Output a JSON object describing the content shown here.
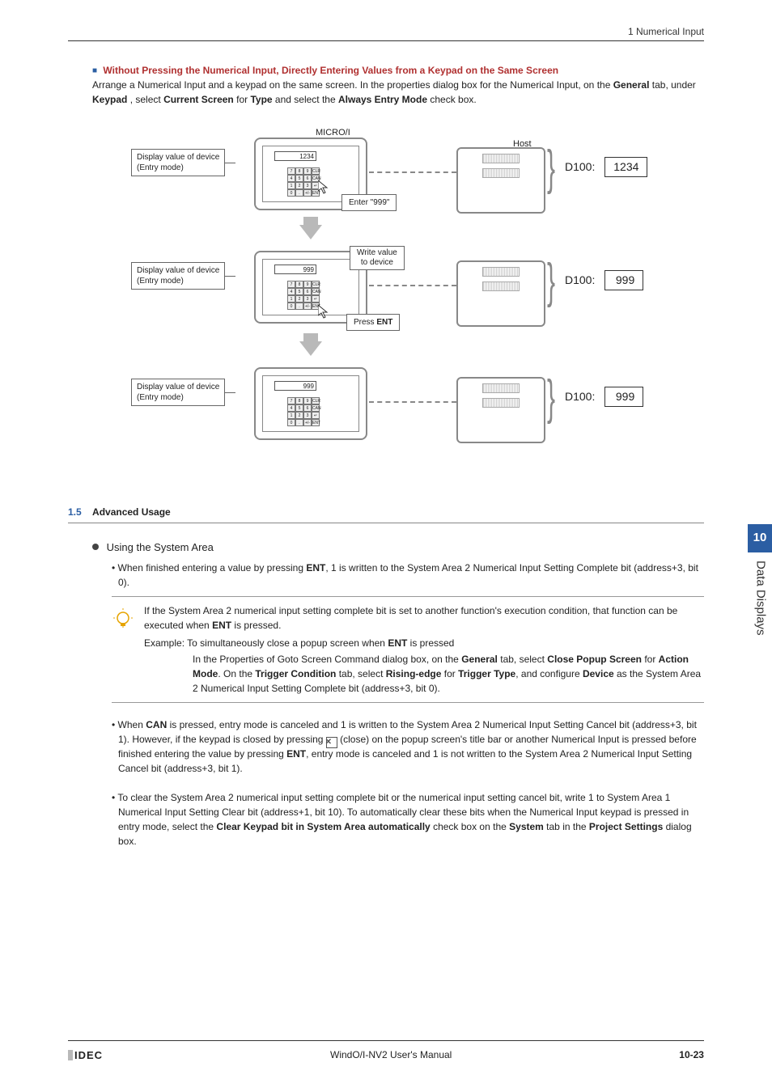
{
  "header": {
    "section": "1 Numerical Input"
  },
  "title_block": {
    "heading": "Without Pressing the Numerical Input, Directly Entering Values from a Keypad on the Same Screen",
    "line1_a": "Arrange a Numerical Input and a keypad on the same screen. In the properties dialog box for the Numerical Input, on the ",
    "general": "General",
    "line1_b": " tab, under ",
    "keypad": "Keypad",
    "line1_c": ", select ",
    "current_screen": "Current Screen",
    "line1_d": " for ",
    "type": "Type",
    "line1_e": " and select the ",
    "always_entry": "Always Entry Mode",
    "line1_f": " check box."
  },
  "diagram": {
    "microi": "MICRO/I",
    "host": "Host",
    "dev1": "Display value of device\n(Entry mode)",
    "val1": "1234",
    "val2": "999",
    "val3": "999",
    "d100": "D100:",
    "hv1": "1234",
    "hv2": "999",
    "hv3": "999",
    "enter999": "Enter \"999\"",
    "writeval": "Write value\nto device",
    "pressent_a": "Press ",
    "pressent_b": "ENT"
  },
  "sec15": {
    "num": "1.5",
    "title": "Advanced Usage",
    "sub": "Using the System Area",
    "li1_a": "When finished entering a value by pressing ",
    "ent": "ENT",
    "li1_b": ", 1 is written to the System Area 2 Numerical Input Setting Complete bit (address+3, bit 0).",
    "tip1_a": "If the System Area 2 numerical input setting complete bit is set to another function's execution condition, that function can be executed when ",
    "tip1_b": " is pressed.",
    "tip_ex_a": "Example:",
    "tip_ex_b": "To simultaneously close a popup screen when ",
    "tip_ex_c": " is pressed",
    "tip_sub_a": "In the Properties of Goto Screen Command dialog box, on the ",
    "general": "General",
    "tip_sub_b": " tab, select ",
    "close_popup": "Close Popup Screen",
    "tip_sub_c": " for ",
    "action_mode": "Action Mode",
    "tip_sub_d": ". On the ",
    "trigger_cond": "Trigger Condition",
    "tip_sub_e": " tab, select ",
    "rising_edge": "Rising-edge",
    "tip_sub_f": " for ",
    "trigger_type": "Trigger Type",
    "tip_sub_g": ", and configure ",
    "device": "Device",
    "tip_sub_h": " as the System Area 2 Numerical Input Setting Complete bit (address+3, bit 0).",
    "li2_a": "When ",
    "can": "CAN",
    "li2_b": " is pressed, entry mode is canceled and 1 is written to the System Area 2 Numerical Input Setting Cancel bit (address+3, bit 1). However, if the keypad is closed by pressing ",
    "li2_c": " (close) on the popup screen's title bar or another Numerical Input is pressed before finished entering the value by pressing ",
    "li2_d": ", entry mode is canceled and 1 is not written to the System Area 2 Numerical Input Setting Cancel bit (address+3, bit 1).",
    "li3_a": "To clear the System Area 2 numerical input setting complete bit or the numerical input setting cancel bit, write 1 to System Area 1 Numerical Input Setting Clear bit (address+1, bit 10). To automatically clear these bits when the Numerical Input keypad is pressed in entry mode, select the ",
    "clear_kp": "Clear Keypad bit in System Area automatically",
    "li3_b": " check box on the ",
    "system": "System",
    "li3_c": " tab in the ",
    "proj_set": "Project Settings",
    "li3_d": " dialog box."
  },
  "sidetab": {
    "num": "10",
    "label": "Data Displays"
  },
  "footer": {
    "brand": "IDEC",
    "manual": "WindO/I-NV2 User's Manual",
    "pg": "10-23"
  }
}
